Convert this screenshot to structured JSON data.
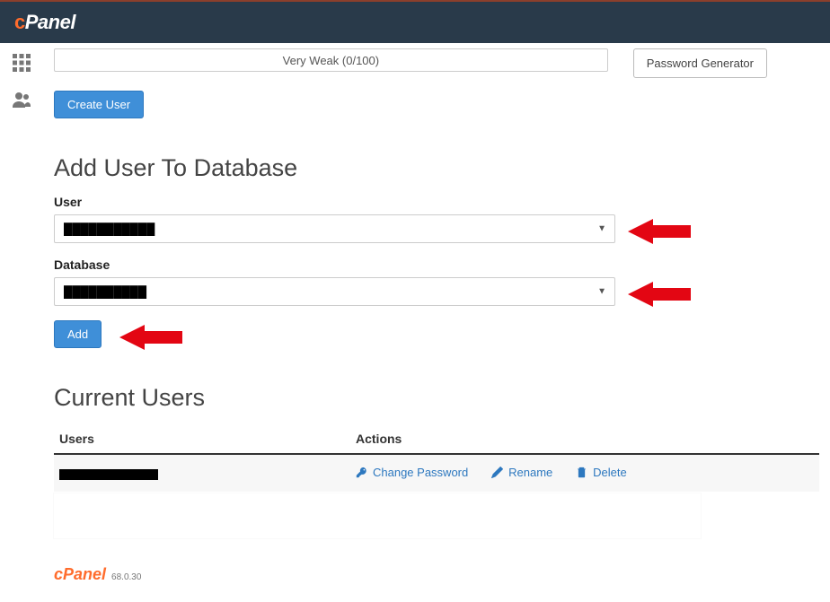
{
  "header": {
    "logo_prefix": "c",
    "logo_text": "Panel"
  },
  "password": {
    "strength_text": "Very Weak (0/100)",
    "generator_button": "Password Generator",
    "create_user_button": "Create User"
  },
  "add_user": {
    "heading": "Add User To Database",
    "user_label": "User",
    "user_selected": "████████",
    "database_label": "Database",
    "database_selected": "████████",
    "add_button": "Add"
  },
  "current_users": {
    "heading": "Current Users",
    "col_users": "Users",
    "col_actions": "Actions",
    "row_user": "████████",
    "actions": {
      "change_password": "Change Password",
      "rename": "Rename",
      "delete": "Delete"
    }
  },
  "footer": {
    "logo": "cPanel",
    "version": "68.0.30"
  }
}
